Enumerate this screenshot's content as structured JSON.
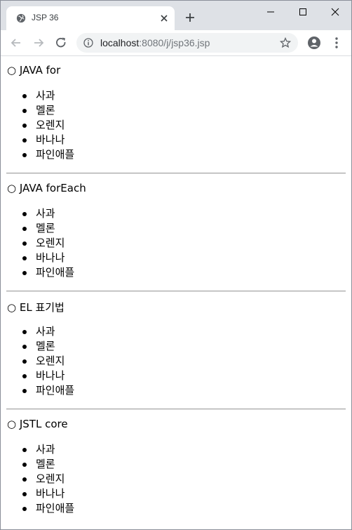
{
  "browser": {
    "tab_title": "JSP 36",
    "url_host": "localhost",
    "url_path": ":8080/j/jsp36.jsp"
  },
  "sections": [
    {
      "title": "○ JAVA for",
      "items": [
        "사과",
        "멜론",
        "오렌지",
        "바나나",
        "파인애플"
      ]
    },
    {
      "title": "○ JAVA forEach",
      "items": [
        "사과",
        "멜론",
        "오렌지",
        "바나나",
        "파인애플"
      ]
    },
    {
      "title": "○ EL 표기법",
      "items": [
        "사과",
        "멜론",
        "오렌지",
        "바나나",
        "파인애플"
      ]
    },
    {
      "title": "○ JSTL core",
      "items": [
        "사과",
        "멜론",
        "오렌지",
        "바나나",
        "파인애플"
      ]
    }
  ],
  "colors": {
    "titlebar": "#dee1e6",
    "omnibox": "#f1f3f4",
    "rule": "#a0a0a0"
  }
}
